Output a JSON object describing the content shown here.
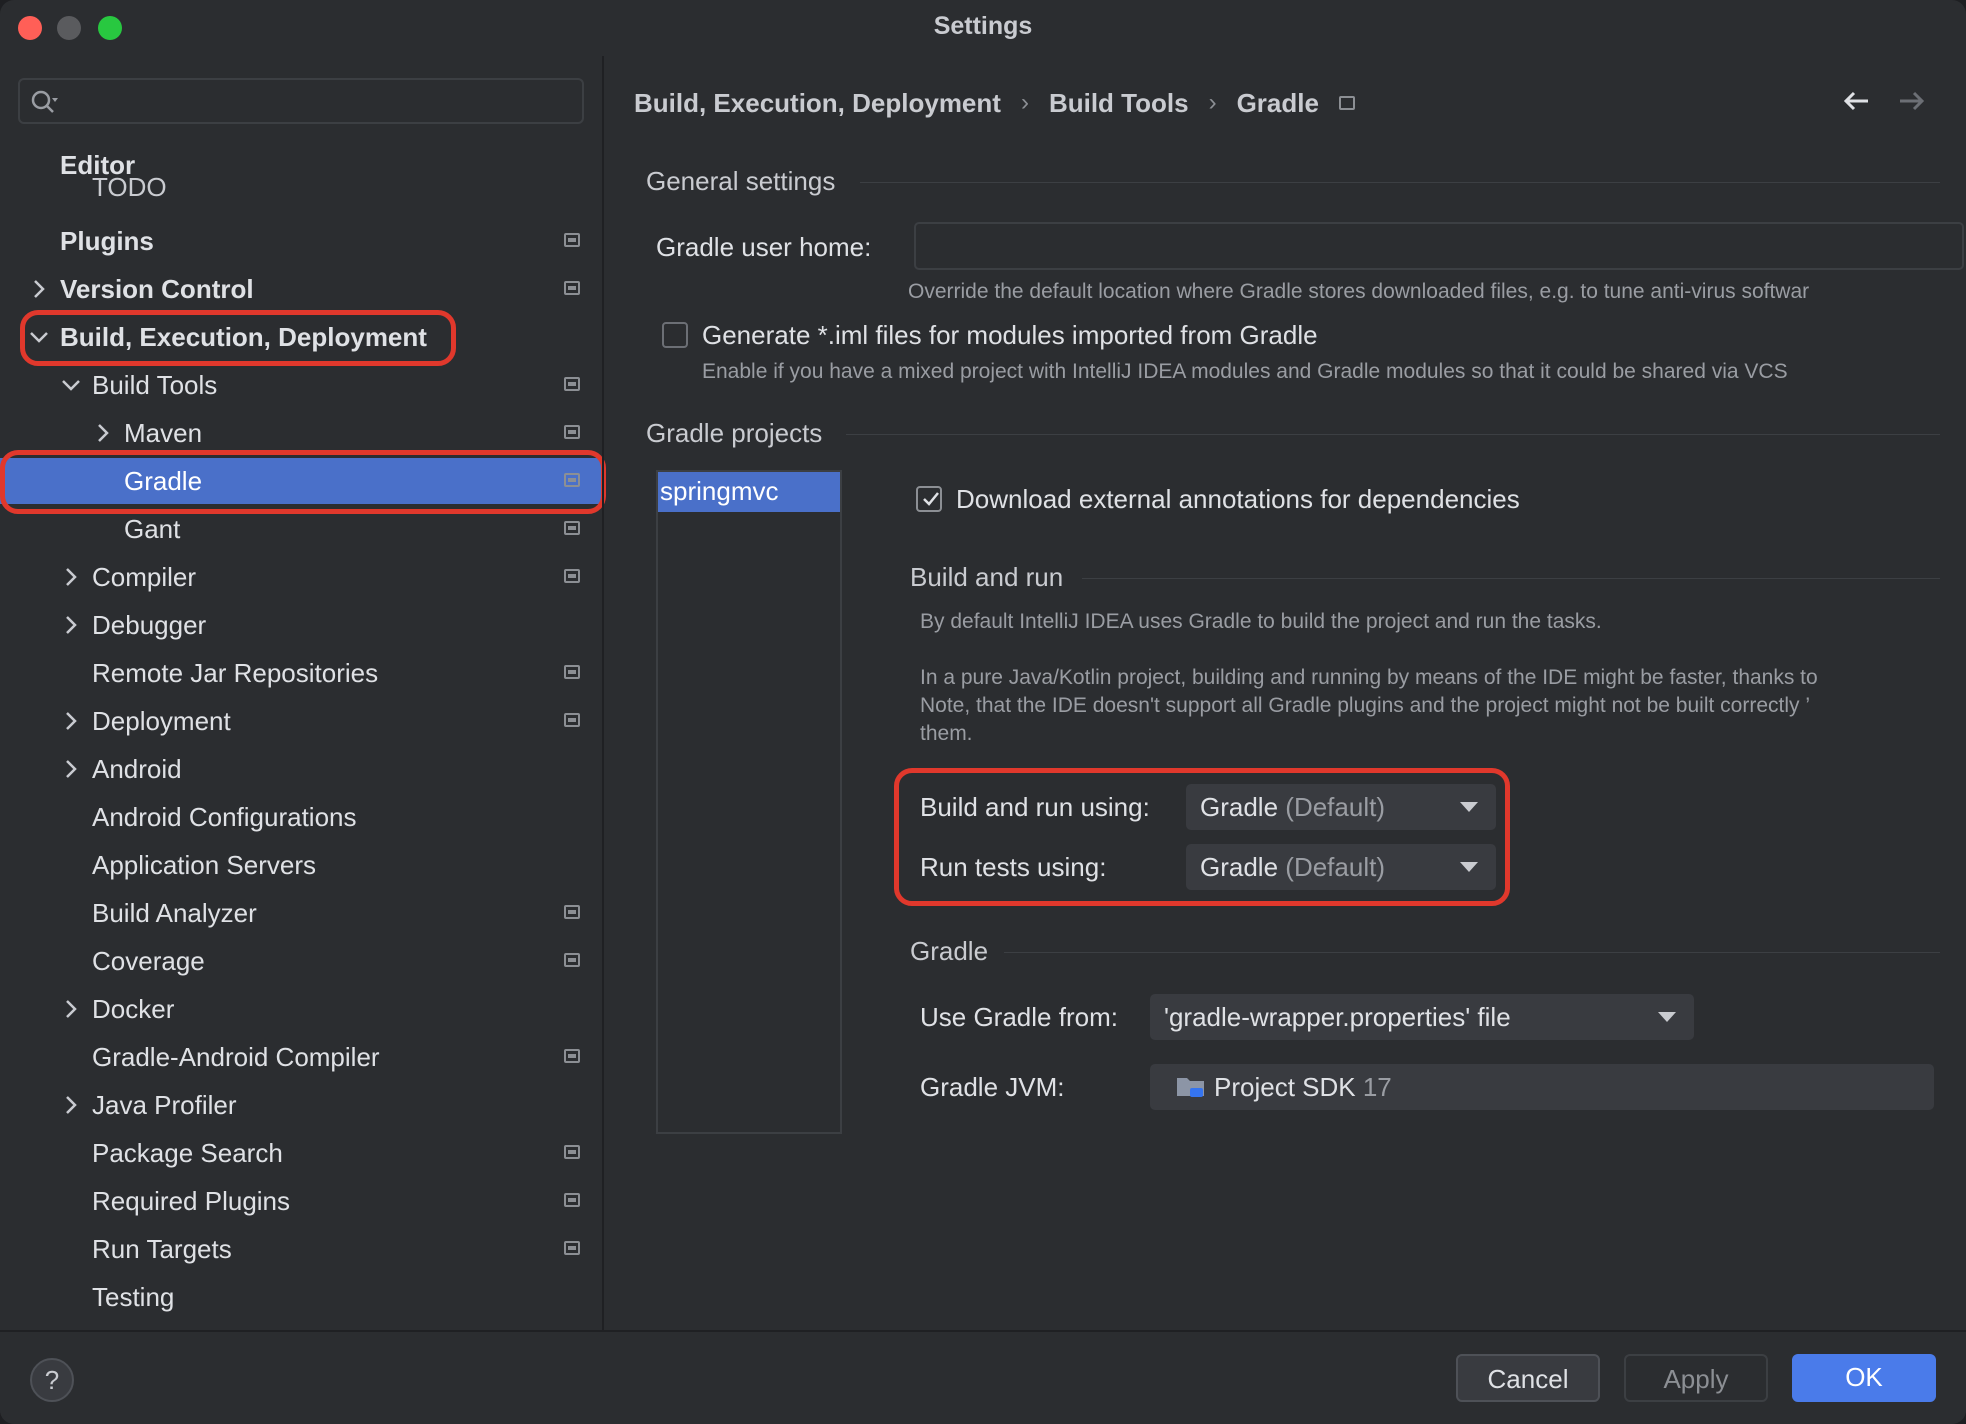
{
  "window": {
    "title": "Settings"
  },
  "sidebar": {
    "search_placeholder": "",
    "todo_label": "TODO",
    "items": [
      {
        "label": "Editor"
      },
      {
        "label": "Plugins"
      },
      {
        "label": "Version Control"
      },
      {
        "label": "Build, Execution, Deployment"
      },
      {
        "label": "Build Tools"
      },
      {
        "label": "Maven"
      },
      {
        "label": "Gradle"
      },
      {
        "label": "Gant"
      },
      {
        "label": "Compiler"
      },
      {
        "label": "Debugger"
      },
      {
        "label": "Remote Jar Repositories"
      },
      {
        "label": "Deployment"
      },
      {
        "label": "Android"
      },
      {
        "label": "Android Configurations"
      },
      {
        "label": "Application Servers"
      },
      {
        "label": "Build Analyzer"
      },
      {
        "label": "Coverage"
      },
      {
        "label": "Docker"
      },
      {
        "label": "Gradle-Android Compiler"
      },
      {
        "label": "Java Profiler"
      },
      {
        "label": "Package Search"
      },
      {
        "label": "Required Plugins"
      },
      {
        "label": "Run Targets"
      },
      {
        "label": "Testing"
      }
    ]
  },
  "breadcrumb": {
    "part1": "Build, Execution, Deployment",
    "part2": "Build Tools",
    "part3": "Gradle",
    "sep": "›"
  },
  "general": {
    "title": "General settings",
    "user_home_label": "Gradle user home:",
    "user_home_value": "",
    "user_home_hint": "Override the default location where Gradle stores downloaded files, e.g. to tune anti-virus softwar",
    "iml_label": "Generate *.iml files for modules imported from Gradle",
    "iml_hint": "Enable if you have a mixed project with IntelliJ IDEA modules and Gradle modules so that it could be shared via VCS"
  },
  "projects": {
    "title": "Gradle projects",
    "items": [
      "springmvc"
    ],
    "download_annotations_label": "Download external annotations for dependencies"
  },
  "build_run": {
    "title": "Build and run",
    "desc1": "By default IntelliJ IDEA uses Gradle to build the project and run the tasks.",
    "desc2a": "In a pure Java/Kotlin project, building and running by means of the IDE might be faster, thanks to",
    "desc2b": "Note, that the IDE doesn't support all Gradle plugins and the project might not be built correctly ’",
    "desc2c": "them.",
    "build_using_label": "Build and run using:",
    "build_using_value": "Gradle",
    "build_using_sub": "(Default)",
    "tests_using_label": "Run tests using:",
    "tests_using_value": "Gradle",
    "tests_using_sub": "(Default)"
  },
  "gradle": {
    "title": "Gradle",
    "use_from_label": "Use Gradle from:",
    "use_from_value": "'gradle-wrapper.properties' file",
    "jvm_label": "Gradle JVM:",
    "jvm_value": "Project SDK",
    "jvm_version": "17"
  },
  "footer": {
    "help": "?",
    "cancel": "Cancel",
    "apply": "Apply",
    "ok": "OK"
  },
  "colors": {
    "accent": "#4a70c9",
    "highlight_ring": "#e0382c",
    "ok_button": "#4a7bea"
  }
}
